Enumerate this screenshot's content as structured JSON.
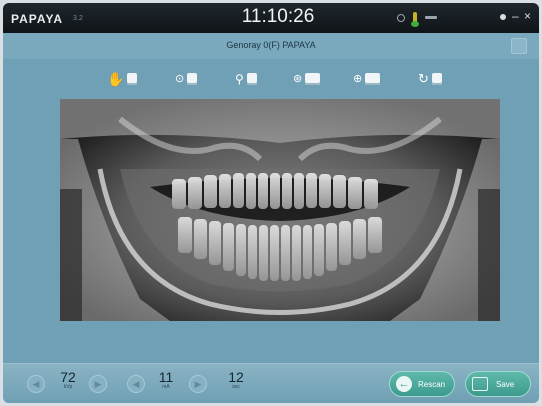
{
  "titlebar": {
    "brand": "PAPAYA",
    "brand_sub": "3.2",
    "clock": "11:10:26"
  },
  "patient_bar": {
    "text": "Genoray   0(F)  PAPAYA"
  },
  "toolbar": {
    "tools": [
      {
        "name": "hand-sensor-icon",
        "glyph": "✋"
      },
      {
        "name": "crosshair-sensor-icon",
        "glyph": "⊙"
      },
      {
        "name": "zoom-sensor-icon",
        "glyph": "🔍"
      },
      {
        "name": "tooth-panel-icon",
        "glyph": "⊛"
      },
      {
        "name": "tooth-split-icon",
        "glyph": "⊕"
      },
      {
        "name": "rotate-sensor-icon",
        "glyph": "↻"
      }
    ]
  },
  "footer": {
    "kvp": {
      "value": "72",
      "unit": "kVp"
    },
    "ma": {
      "value": "11",
      "unit": "mA"
    },
    "sec": {
      "value": "12",
      "unit": "sec"
    },
    "rescan_label": "Rescan",
    "save_label": "Save"
  },
  "colors": {
    "background": "#6fa0b6",
    "titlebar": "#161d21",
    "accent": "#4aa99b"
  }
}
